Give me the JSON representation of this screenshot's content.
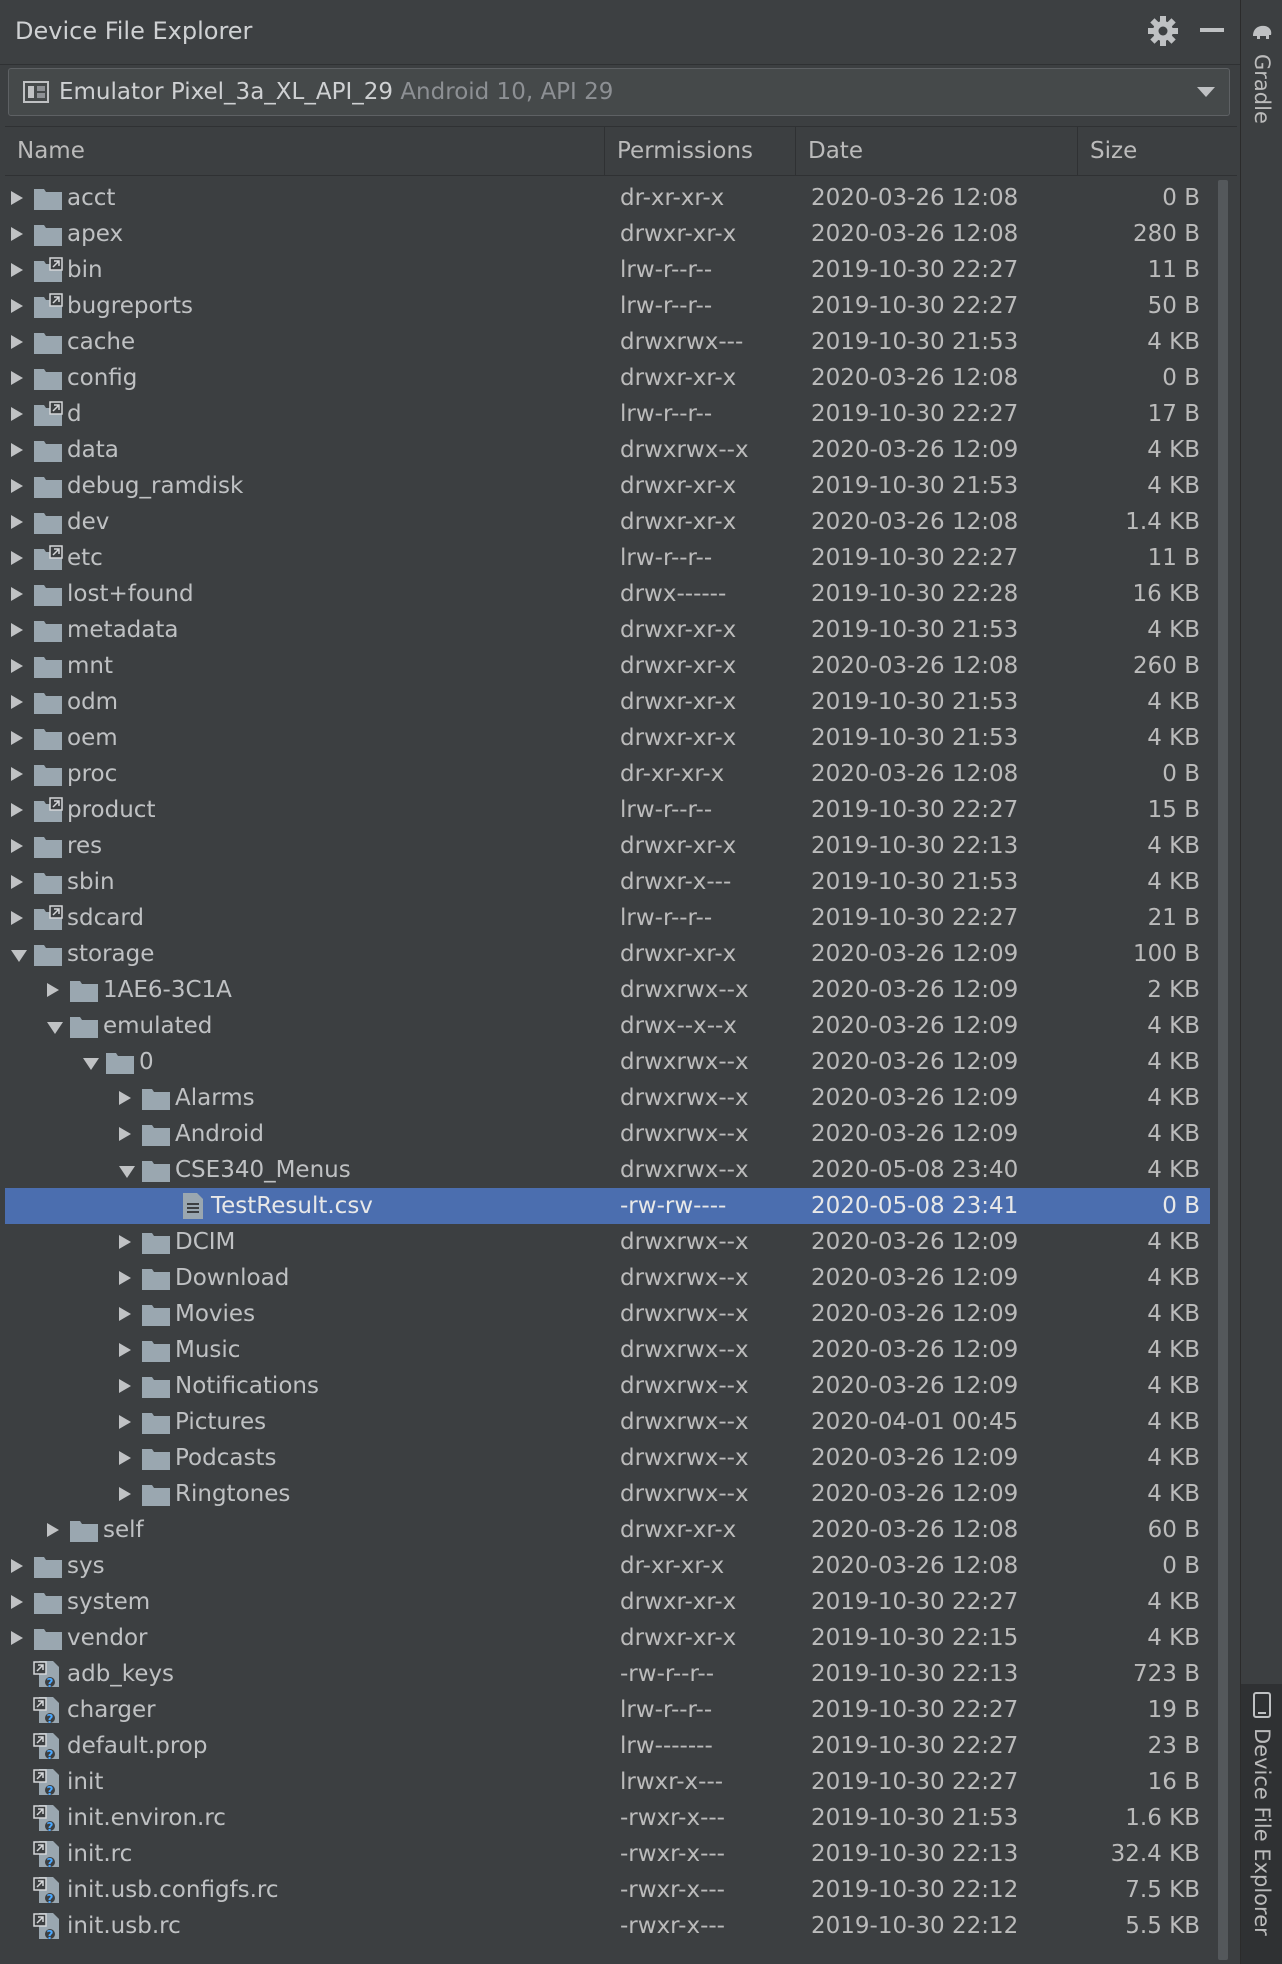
{
  "panel": {
    "title": "Device File Explorer",
    "icons": [
      "gear-icon",
      "minimize-icon"
    ]
  },
  "device": {
    "name": "Emulator Pixel_3a_XL_API_29",
    "detail": "Android 10, API 29"
  },
  "columns": {
    "name": "Name",
    "permissions": "Permissions",
    "date": "Date",
    "size": "Size"
  },
  "right_toolbar": {
    "gradle": "Gradle",
    "device_file_explorer": "Device File Explorer"
  },
  "colors": {
    "background": "#3c3f41",
    "selection": "#4b6eaf",
    "folder": "#9aa7b0"
  },
  "rows": [
    {
      "name": "acct",
      "type": "folder",
      "depth": 0,
      "expand": "closed",
      "perm": "dr-xr-xr-x",
      "date": "2020-03-26 12:08",
      "size": "0 B"
    },
    {
      "name": "apex",
      "type": "folder",
      "depth": 0,
      "expand": "closed",
      "perm": "drwxr-xr-x",
      "date": "2020-03-26 12:08",
      "size": "280 B"
    },
    {
      "name": "bin",
      "type": "link",
      "depth": 0,
      "expand": "closed",
      "perm": "lrw-r--r--",
      "date": "2019-10-30 22:27",
      "size": "11 B"
    },
    {
      "name": "bugreports",
      "type": "link",
      "depth": 0,
      "expand": "closed",
      "perm": "lrw-r--r--",
      "date": "2019-10-30 22:27",
      "size": "50 B"
    },
    {
      "name": "cache",
      "type": "folder",
      "depth": 0,
      "expand": "closed",
      "perm": "drwxrwx---",
      "date": "2019-10-30 21:53",
      "size": "4 KB"
    },
    {
      "name": "config",
      "type": "folder",
      "depth": 0,
      "expand": "closed",
      "perm": "drwxr-xr-x",
      "date": "2020-03-26 12:08",
      "size": "0 B"
    },
    {
      "name": "d",
      "type": "link",
      "depth": 0,
      "expand": "closed",
      "perm": "lrw-r--r--",
      "date": "2019-10-30 22:27",
      "size": "17 B"
    },
    {
      "name": "data",
      "type": "folder",
      "depth": 0,
      "expand": "closed",
      "perm": "drwxrwx--x",
      "date": "2020-03-26 12:09",
      "size": "4 KB"
    },
    {
      "name": "debug_ramdisk",
      "type": "folder",
      "depth": 0,
      "expand": "closed",
      "perm": "drwxr-xr-x",
      "date": "2019-10-30 21:53",
      "size": "4 KB"
    },
    {
      "name": "dev",
      "type": "folder",
      "depth": 0,
      "expand": "closed",
      "perm": "drwxr-xr-x",
      "date": "2020-03-26 12:08",
      "size": "1.4 KB"
    },
    {
      "name": "etc",
      "type": "link",
      "depth": 0,
      "expand": "closed",
      "perm": "lrw-r--r--",
      "date": "2019-10-30 22:27",
      "size": "11 B"
    },
    {
      "name": "lost+found",
      "type": "folder",
      "depth": 0,
      "expand": "closed",
      "perm": "drwx------",
      "date": "2019-10-30 22:28",
      "size": "16 KB"
    },
    {
      "name": "metadata",
      "type": "folder",
      "depth": 0,
      "expand": "closed",
      "perm": "drwxr-xr-x",
      "date": "2019-10-30 21:53",
      "size": "4 KB"
    },
    {
      "name": "mnt",
      "type": "folder",
      "depth": 0,
      "expand": "closed",
      "perm": "drwxr-xr-x",
      "date": "2020-03-26 12:08",
      "size": "260 B"
    },
    {
      "name": "odm",
      "type": "folder",
      "depth": 0,
      "expand": "closed",
      "perm": "drwxr-xr-x",
      "date": "2019-10-30 21:53",
      "size": "4 KB"
    },
    {
      "name": "oem",
      "type": "folder",
      "depth": 0,
      "expand": "closed",
      "perm": "drwxr-xr-x",
      "date": "2019-10-30 21:53",
      "size": "4 KB"
    },
    {
      "name": "proc",
      "type": "folder",
      "depth": 0,
      "expand": "closed",
      "perm": "dr-xr-xr-x",
      "date": "2020-03-26 12:08",
      "size": "0 B"
    },
    {
      "name": "product",
      "type": "link",
      "depth": 0,
      "expand": "closed",
      "perm": "lrw-r--r--",
      "date": "2019-10-30 22:27",
      "size": "15 B"
    },
    {
      "name": "res",
      "type": "folder",
      "depth": 0,
      "expand": "closed",
      "perm": "drwxr-xr-x",
      "date": "2019-10-30 22:13",
      "size": "4 KB"
    },
    {
      "name": "sbin",
      "type": "folder",
      "depth": 0,
      "expand": "closed",
      "perm": "drwxr-x---",
      "date": "2019-10-30 21:53",
      "size": "4 KB"
    },
    {
      "name": "sdcard",
      "type": "link",
      "depth": 0,
      "expand": "closed",
      "perm": "lrw-r--r--",
      "date": "2019-10-30 22:27",
      "size": "21 B"
    },
    {
      "name": "storage",
      "type": "folder",
      "depth": 0,
      "expand": "open",
      "perm": "drwxr-xr-x",
      "date": "2020-03-26 12:09",
      "size": "100 B"
    },
    {
      "name": "1AE6-3C1A",
      "type": "folder",
      "depth": 1,
      "expand": "closed",
      "perm": "drwxrwx--x",
      "date": "2020-03-26 12:09",
      "size": "2 KB"
    },
    {
      "name": "emulated",
      "type": "folder",
      "depth": 1,
      "expand": "open",
      "perm": "drwx--x--x",
      "date": "2020-03-26 12:09",
      "size": "4 KB"
    },
    {
      "name": "0",
      "type": "folder",
      "depth": 2,
      "expand": "open",
      "perm": "drwxrwx--x",
      "date": "2020-03-26 12:09",
      "size": "4 KB"
    },
    {
      "name": "Alarms",
      "type": "folder",
      "depth": 3,
      "expand": "closed",
      "perm": "drwxrwx--x",
      "date": "2020-03-26 12:09",
      "size": "4 KB"
    },
    {
      "name": "Android",
      "type": "folder",
      "depth": 3,
      "expand": "closed",
      "perm": "drwxrwx--x",
      "date": "2020-03-26 12:09",
      "size": "4 KB"
    },
    {
      "name": "CSE340_Menus",
      "type": "folder",
      "depth": 3,
      "expand": "open",
      "perm": "drwxrwx--x",
      "date": "2020-05-08 23:40",
      "size": "4 KB"
    },
    {
      "name": "TestResult.csv",
      "type": "file",
      "depth": 4,
      "expand": "none",
      "perm": "-rw-rw----",
      "date": "2020-05-08 23:41",
      "size": "0 B",
      "selected": true
    },
    {
      "name": "DCIM",
      "type": "folder",
      "depth": 3,
      "expand": "closed",
      "perm": "drwxrwx--x",
      "date": "2020-03-26 12:09",
      "size": "4 KB"
    },
    {
      "name": "Download",
      "type": "folder",
      "depth": 3,
      "expand": "closed",
      "perm": "drwxrwx--x",
      "date": "2020-03-26 12:09",
      "size": "4 KB"
    },
    {
      "name": "Movies",
      "type": "folder",
      "depth": 3,
      "expand": "closed",
      "perm": "drwxrwx--x",
      "date": "2020-03-26 12:09",
      "size": "4 KB"
    },
    {
      "name": "Music",
      "type": "folder",
      "depth": 3,
      "expand": "closed",
      "perm": "drwxrwx--x",
      "date": "2020-03-26 12:09",
      "size": "4 KB"
    },
    {
      "name": "Notifications",
      "type": "folder",
      "depth": 3,
      "expand": "closed",
      "perm": "drwxrwx--x",
      "date": "2020-03-26 12:09",
      "size": "4 KB"
    },
    {
      "name": "Pictures",
      "type": "folder",
      "depth": 3,
      "expand": "closed",
      "perm": "drwxrwx--x",
      "date": "2020-04-01 00:45",
      "size": "4 KB"
    },
    {
      "name": "Podcasts",
      "type": "folder",
      "depth": 3,
      "expand": "closed",
      "perm": "drwxrwx--x",
      "date": "2020-03-26 12:09",
      "size": "4 KB"
    },
    {
      "name": "Ringtones",
      "type": "folder",
      "depth": 3,
      "expand": "closed",
      "perm": "drwxrwx--x",
      "date": "2020-03-26 12:09",
      "size": "4 KB"
    },
    {
      "name": "self",
      "type": "folder",
      "depth": 1,
      "expand": "closed",
      "perm": "drwxr-xr-x",
      "date": "2020-03-26 12:08",
      "size": "60 B"
    },
    {
      "name": "sys",
      "type": "folder",
      "depth": 0,
      "expand": "closed",
      "perm": "dr-xr-xr-x",
      "date": "2020-03-26 12:08",
      "size": "0 B"
    },
    {
      "name": "system",
      "type": "folder",
      "depth": 0,
      "expand": "closed",
      "perm": "drwxr-xr-x",
      "date": "2019-10-30 22:27",
      "size": "4 KB"
    },
    {
      "name": "vendor",
      "type": "folder",
      "depth": 0,
      "expand": "closed",
      "perm": "drwxr-xr-x",
      "date": "2019-10-30 22:15",
      "size": "4 KB"
    },
    {
      "name": "adb_keys",
      "type": "unknown",
      "depth": 0,
      "expand": "none",
      "perm": "-rw-r--r--",
      "date": "2019-10-30 22:13",
      "size": "723 B"
    },
    {
      "name": "charger",
      "type": "unknown",
      "depth": 0,
      "expand": "none",
      "perm": "lrw-r--r--",
      "date": "2019-10-30 22:27",
      "size": "19 B"
    },
    {
      "name": "default.prop",
      "type": "unknown",
      "depth": 0,
      "expand": "none",
      "perm": "lrw-------",
      "date": "2019-10-30 22:27",
      "size": "23 B"
    },
    {
      "name": "init",
      "type": "unknown",
      "depth": 0,
      "expand": "none",
      "perm": "lrwxr-x---",
      "date": "2019-10-30 22:27",
      "size": "16 B"
    },
    {
      "name": "init.environ.rc",
      "type": "unknown",
      "depth": 0,
      "expand": "none",
      "perm": "-rwxr-x---",
      "date": "2019-10-30 21:53",
      "size": "1.6 KB"
    },
    {
      "name": "init.rc",
      "type": "unknown",
      "depth": 0,
      "expand": "none",
      "perm": "-rwxr-x---",
      "date": "2019-10-30 22:13",
      "size": "32.4 KB"
    },
    {
      "name": "init.usb.configfs.rc",
      "type": "unknown",
      "depth": 0,
      "expand": "none",
      "perm": "-rwxr-x---",
      "date": "2019-10-30 22:12",
      "size": "7.5 KB"
    },
    {
      "name": "init.usb.rc",
      "type": "unknown",
      "depth": 0,
      "expand": "none",
      "perm": "-rwxr-x---",
      "date": "2019-10-30 22:12",
      "size": "5.5 KB"
    }
  ]
}
